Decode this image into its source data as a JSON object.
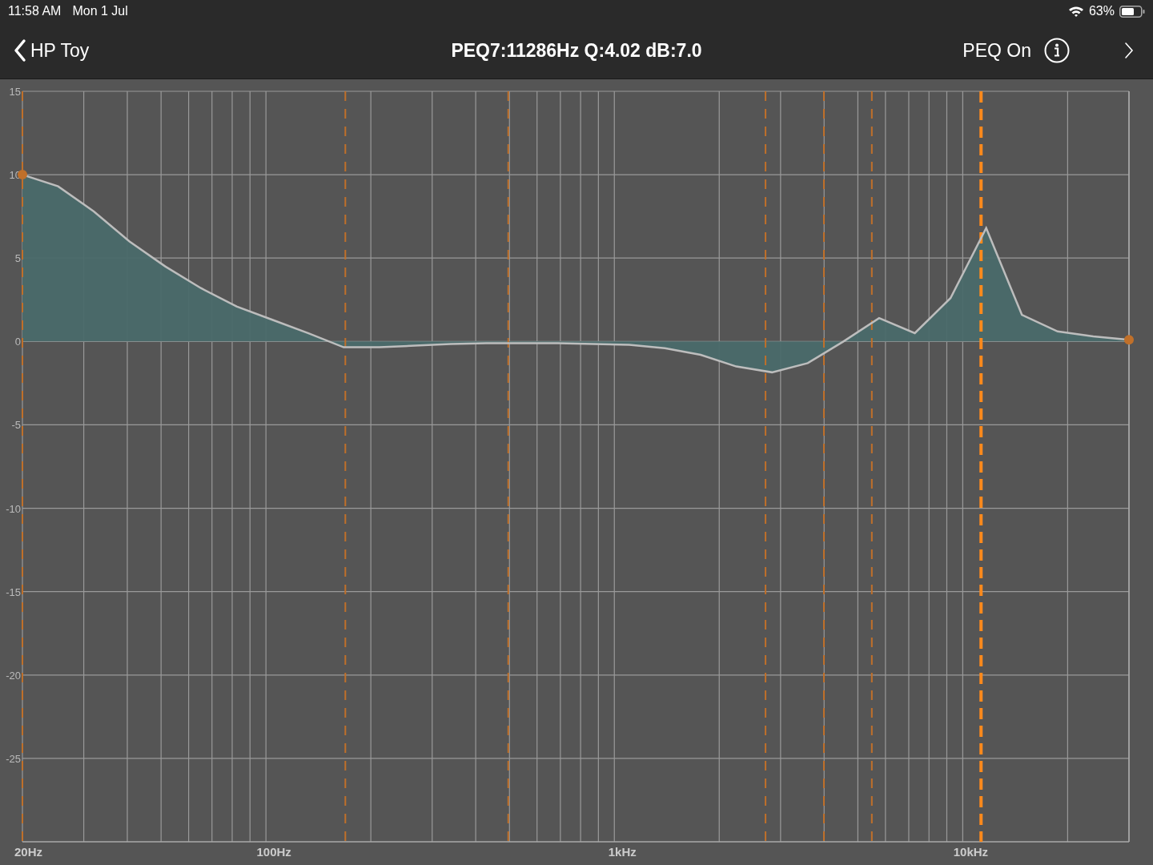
{
  "status_bar": {
    "time": "11:58 AM",
    "date": "Mon 1 Jul",
    "battery": "63%"
  },
  "nav_bar": {
    "back": "HP Toy",
    "title": "PEQ7:11286Hz Q:4.02 dB:7.0",
    "peq_toggle": "PEQ On"
  },
  "chart_data": {
    "type": "area",
    "ylim": [
      -30,
      15
    ],
    "categories": [
      null,
      null,
      null,
      null,
      null,
      null,
      null,
      null,
      null,
      null,
      null,
      null,
      null,
      null,
      null,
      null,
      null,
      null,
      null,
      null,
      null,
      null,
      null,
      null,
      null,
      null,
      null,
      null,
      null,
      null,
      null,
      null
    ],
    "series": [
      {
        "color": "#bdbdbd",
        "values": [
          10,
          9.3,
          7.8,
          6.0,
          4.5,
          3.2,
          2.1,
          1.3,
          0.5,
          -0.35,
          -0.35,
          -0.25,
          -0.15,
          -0.1,
          -0.1,
          -0.1,
          -0.15,
          -0.2,
          -0.4,
          -0.8,
          -1.5,
          -1.85,
          -1.3,
          0.0,
          1.4,
          0.5,
          2.6,
          6.8,
          1.6,
          0.6,
          0.3,
          0.1
        ]
      }
    ],
    "yticks": [
      15,
      10,
      5,
      0,
      -5,
      -10,
      -15,
      -20,
      -25
    ],
    "grid": true
  },
  "x_axis_labels": [
    "20Hz",
    "100Hz",
    "1kHz",
    "10kHz"
  ],
  "filters": [
    {
      "selected": false
    },
    {
      "selected": false
    },
    {
      "selected": false
    },
    {
      "selected": false
    },
    {
      "selected": false
    },
    {
      "selected": false
    },
    {
      "selected": true
    }
  ]
}
